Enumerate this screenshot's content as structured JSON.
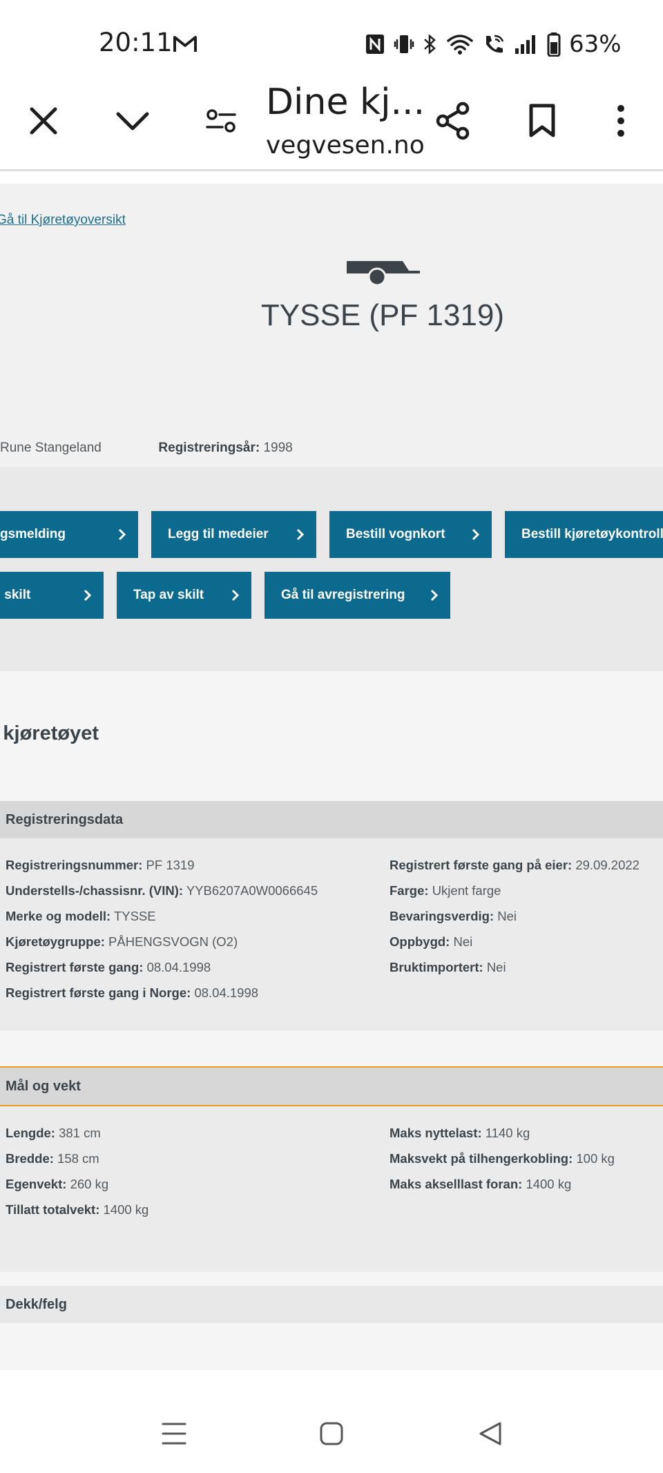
{
  "status_bar": {
    "time": "20:11",
    "battery_text": "63%",
    "icons": [
      "gmail-icon",
      "nfc-icon",
      "vibrate-icon",
      "bluetooth-icon",
      "wifi-icon",
      "wifi-calling-icon",
      "signal-icon",
      "battery-icon"
    ]
  },
  "browser": {
    "title": "Dine kj...",
    "domain": "vegvesen.no",
    "icons": [
      "close-icon",
      "chevron-down-icon",
      "page-settings-icon",
      "share-icon",
      "bookmark-icon",
      "more-vert-icon"
    ]
  },
  "page": {
    "back_link": "Gå til Kjøretøyoversikt",
    "vehicle_title": "TYSSE (PF 1319)",
    "owner_name": "Rune Stangeland",
    "reg_year_label": "Registreringsår:",
    "reg_year_value": "1998",
    "actions": [
      {
        "label": "Ny salgsmelding"
      },
      {
        "label": "Legg til medeier"
      },
      {
        "label": "Bestill vognkort"
      },
      {
        "label": "Bestill kjøretøykontroll"
      },
      {
        "label": "Bestill skilt"
      },
      {
        "label": "Tap av skilt"
      },
      {
        "label": "Gå til avregistrering"
      }
    ],
    "section_heading": "Om kjøretøyet",
    "registreringsdata": {
      "title": "Registreringsdata",
      "left": [
        {
          "label": "Registreringsnummer:",
          "value": "PF 1319"
        },
        {
          "label": "Understells-/chassisnr. (VIN):",
          "value": "YYB6207A0W0066645"
        },
        {
          "label": "Merke og modell:",
          "value": "TYSSE"
        },
        {
          "label": "Kjøretøygruppe:",
          "value": "PÅHENGSVOGN (O2)"
        },
        {
          "label": "Registrert første gang:",
          "value": "08.04.1998"
        },
        {
          "label": "Registrert første gang i Norge:",
          "value": "08.04.1998"
        }
      ],
      "right": [
        {
          "label": "Registrert første gang på eier:",
          "value": "29.09.2022"
        },
        {
          "label": "Farge:",
          "value": "Ukjent farge"
        },
        {
          "label": "Bevaringsverdig:",
          "value": "Nei"
        },
        {
          "label": "Oppbygd:",
          "value": "Nei"
        },
        {
          "label": "Bruktimportert:",
          "value": "Nei"
        }
      ]
    },
    "maal_og_vekt": {
      "title": "Mål og vekt",
      "left": [
        {
          "label": "Lengde:",
          "value": "381 cm"
        },
        {
          "label": "Bredde:",
          "value": "158 cm"
        },
        {
          "label": "Egenvekt:",
          "value": "260 kg"
        },
        {
          "label": "Tillatt totalvekt:",
          "value": "1400 kg"
        }
      ],
      "right": [
        {
          "label": "Maks nyttelast:",
          "value": "1140 kg"
        },
        {
          "label": "Maksvekt på tilhengerkobling:",
          "value": "100 kg"
        },
        {
          "label": "Maks akselllast foran:",
          "value": "1400 kg"
        }
      ]
    },
    "dekk_felg": {
      "title": "Dekk/felg"
    }
  },
  "colors": {
    "button": "#0c6a8e",
    "accent_border": "#ef9a22",
    "text": "#3d4449",
    "footer": "#3d4449"
  }
}
